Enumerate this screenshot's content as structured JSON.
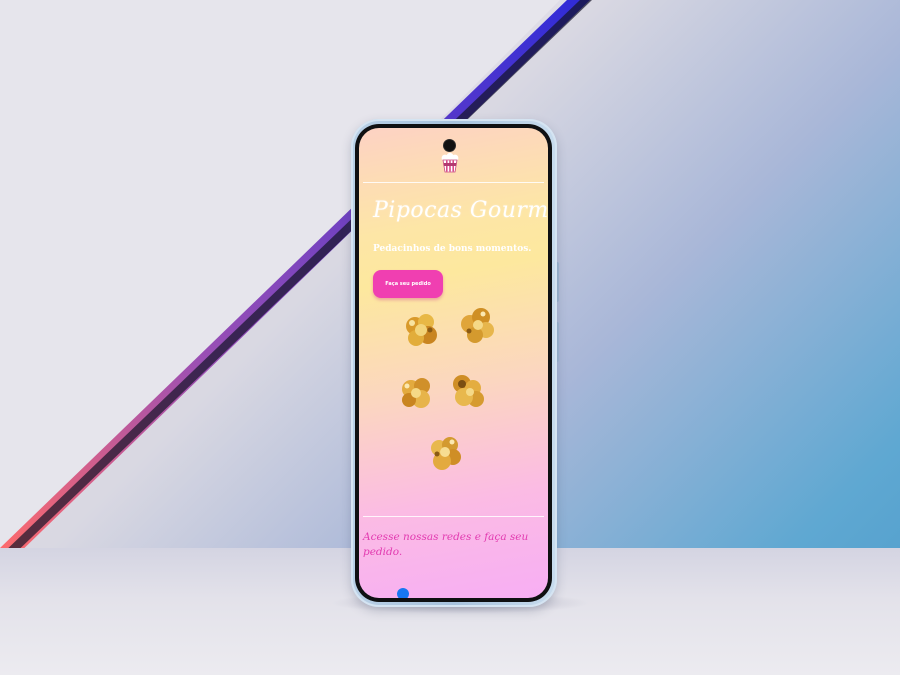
{
  "app": {
    "title": "Pipocas Gourmet",
    "subtitle": "Pedacinhos de bons momentos.",
    "order_button_label": "Faça seu pedido",
    "social_text": "Acesse nossas redes e faça seu pedido."
  },
  "colors": {
    "accent": "#f03fb1",
    "social_text": "#e23bb0",
    "title_text": "#ffffff",
    "phone_frame": "#b9d0e6"
  },
  "icons": {
    "logo": "popcorn-bucket-icon",
    "social": "facebook-icon"
  }
}
